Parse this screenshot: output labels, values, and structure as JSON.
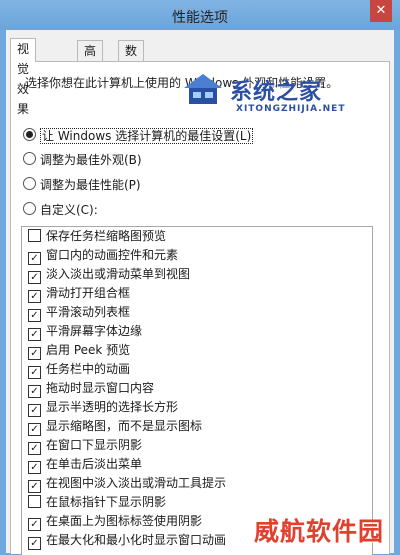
{
  "window": {
    "title": "性能选项",
    "close_glyph": "✕"
  },
  "tabs": [
    {
      "label": "视觉效果",
      "active": true
    },
    {
      "label": "高级",
      "active": false
    },
    {
      "label": "数据执行保护",
      "active": false
    }
  ],
  "description": "选择你想在此计算机上使用的 Windows 外观和性能设置。",
  "radios": [
    {
      "label": "让 Windows 选择计算机的最佳设置(L)",
      "checked": true
    },
    {
      "label": "调整为最佳外观(B)",
      "checked": false
    },
    {
      "label": "调整为最佳性能(P)",
      "checked": false
    },
    {
      "label": "自定义(C):",
      "checked": false
    }
  ],
  "effects": [
    {
      "label": "保存任务栏缩略图预览",
      "checked": false
    },
    {
      "label": "窗口内的动画控件和元素",
      "checked": true
    },
    {
      "label": "淡入淡出或滑动菜单到视图",
      "checked": true
    },
    {
      "label": "滑动打开组合框",
      "checked": true
    },
    {
      "label": "平滑滚动列表框",
      "checked": true
    },
    {
      "label": "平滑屏幕字体边缘",
      "checked": true
    },
    {
      "label": "启用 Peek 预览",
      "checked": true
    },
    {
      "label": "任务栏中的动画",
      "checked": true
    },
    {
      "label": "拖动时显示窗口内容",
      "checked": true
    },
    {
      "label": "显示半透明的选择长方形",
      "checked": true
    },
    {
      "label": "显示缩略图，而不是显示图标",
      "checked": true
    },
    {
      "label": "在窗口下显示阴影",
      "checked": true
    },
    {
      "label": "在单击后淡出菜单",
      "checked": true
    },
    {
      "label": "在视图中淡入淡出或滑动工具提示",
      "checked": true
    },
    {
      "label": "在鼠标指针下显示阴影",
      "checked": false
    },
    {
      "label": "在桌面上为图标标签使用阴影",
      "checked": true
    },
    {
      "label": "在最大化和最小化时显示窗口动画",
      "checked": true
    }
  ],
  "watermarks": {
    "site_name": "系统之家",
    "site_domain": "XITONGZHIJIA.NET",
    "site2_name": "威航软件园"
  },
  "colors": {
    "titlebar": "#6ca5da",
    "close": "#c7463f",
    "watermark_red": "#e0412f"
  }
}
